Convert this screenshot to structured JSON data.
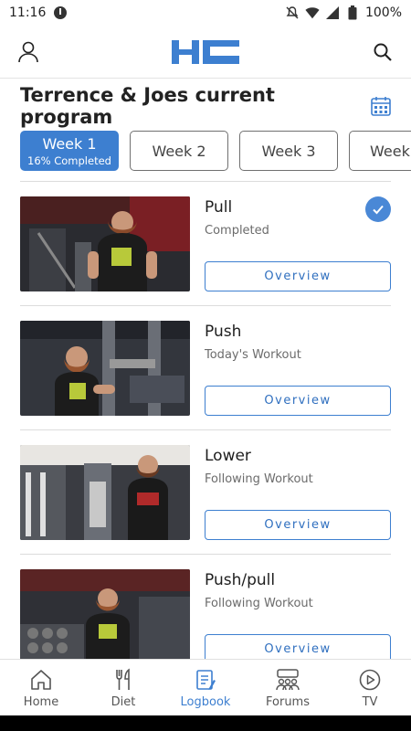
{
  "status_bar": {
    "time": "11:16",
    "battery": "100%"
  },
  "header": {
    "logo_text": "HC"
  },
  "program": {
    "title": "Terrence & Joes current program"
  },
  "weeks": [
    {
      "label": "Week 1",
      "sub": "16% Completed",
      "active": true
    },
    {
      "label": "Week 2",
      "sub": ""
    },
    {
      "label": "Week 3",
      "sub": ""
    },
    {
      "label": "Week",
      "sub": ""
    }
  ],
  "workouts": [
    {
      "name": "Pull",
      "status": "Completed",
      "button": "Overview",
      "completed": true
    },
    {
      "name": "Push",
      "status": "Today's Workout",
      "button": "Overview",
      "completed": false
    },
    {
      "name": "Lower",
      "status": "Following Workout",
      "button": "Overview",
      "completed": false
    },
    {
      "name": "Push/pull",
      "status": "Following Workout",
      "button": "Overview",
      "completed": false
    }
  ],
  "nav": [
    {
      "label": "Home",
      "icon": "home-icon"
    },
    {
      "label": "Diet",
      "icon": "fork-knife-icon"
    },
    {
      "label": "Logbook",
      "icon": "logbook-icon",
      "active": true
    },
    {
      "label": "Forums",
      "icon": "forums-icon"
    },
    {
      "label": "TV",
      "icon": "tv-play-icon"
    }
  ],
  "colors": {
    "accent": "#3d7fd0",
    "divider": "#dcdcdc"
  }
}
